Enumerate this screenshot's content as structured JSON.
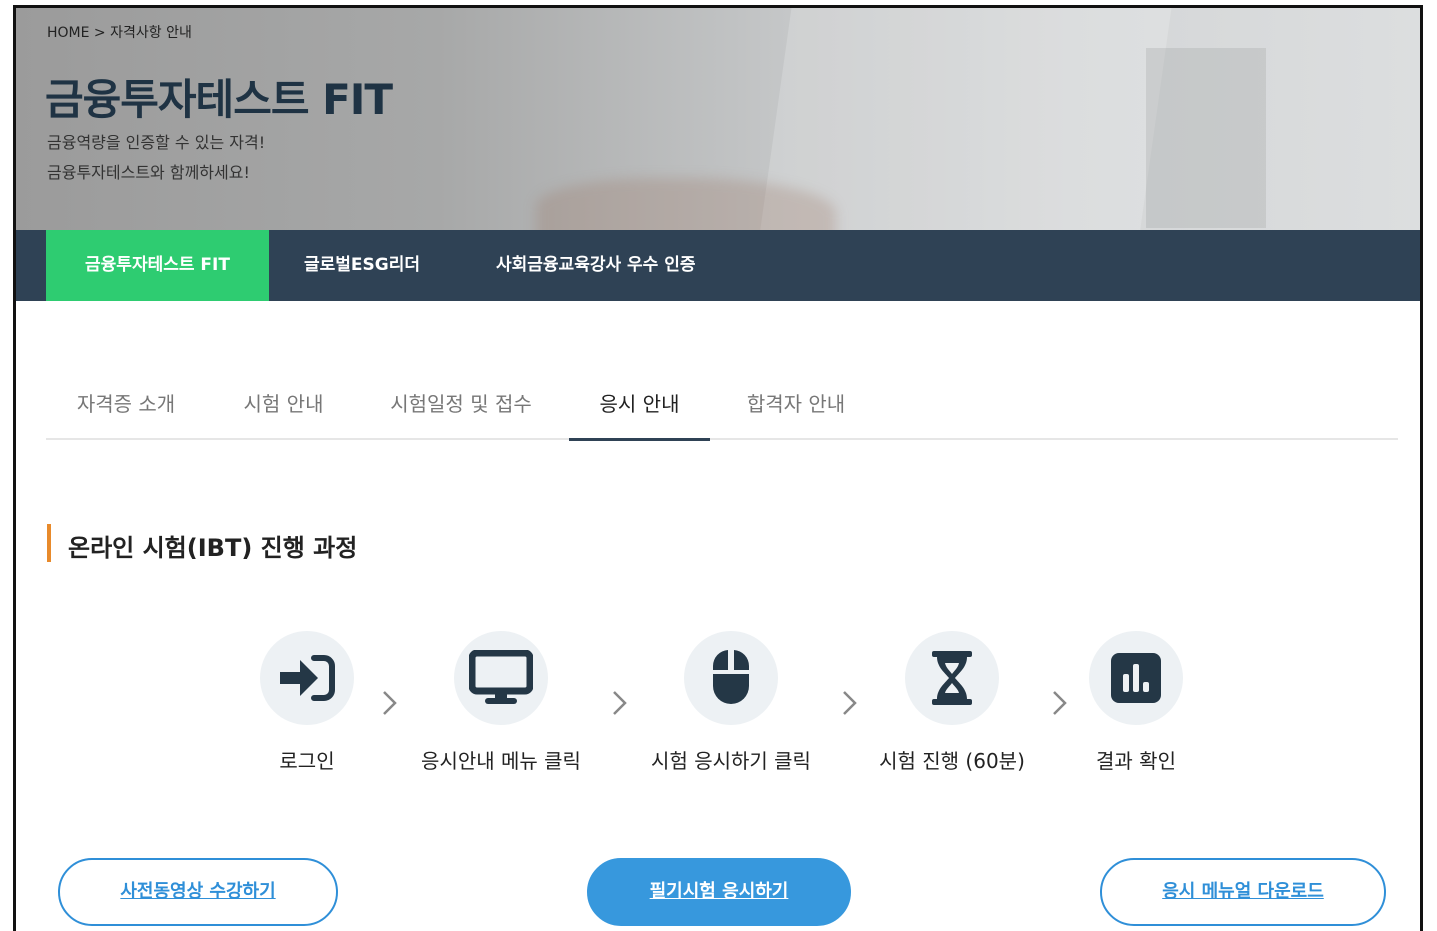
{
  "header": {
    "breadcrumb": "HOME > 자격사항 안내",
    "title": "금융투자테스트 FIT",
    "subtitle_line1": "금융역량을 인증할 수 있는 자격!",
    "subtitle_line2": "금융투자테스트와 함께하세요!"
  },
  "category_nav": {
    "items": [
      {
        "label": "금융투자테스트 FIT",
        "active": true
      },
      {
        "label": "글로벌ESG리더",
        "active": false
      },
      {
        "label": "사회금융교육강사 우수 인증",
        "active": false
      }
    ]
  },
  "sub_tabs": {
    "items": [
      {
        "label": "자격증 소개",
        "active": false
      },
      {
        "label": "시험 안내",
        "active": false
      },
      {
        "label": "시험일정 및 접수",
        "active": false
      },
      {
        "label": "응시 안내",
        "active": true
      },
      {
        "label": "합격자 안내",
        "active": false
      }
    ]
  },
  "section": {
    "title": "온라인 시험(IBT) 진행 과정"
  },
  "steps": [
    {
      "label": "로그인",
      "icon": "login-icon"
    },
    {
      "label": "응시안내 메뉴 클릭",
      "icon": "monitor-icon"
    },
    {
      "label": "시험 응시하기 클릭",
      "icon": "mouse-icon"
    },
    {
      "label": "시험 진행 (60분)",
      "icon": "hourglass-icon"
    },
    {
      "label": "결과 확인",
      "icon": "bar-chart-icon"
    }
  ],
  "buttons": {
    "video": "사전동영상 수강하기",
    "exam": "필기시험 응시하기",
    "manual": "응시 메뉴얼 다운로드"
  },
  "colors": {
    "nav_bg": "#2f4255",
    "active_green": "#2ecc71",
    "accent_orange": "#e88a2b",
    "button_blue": "#3798dd",
    "icon_dark": "#243746"
  }
}
